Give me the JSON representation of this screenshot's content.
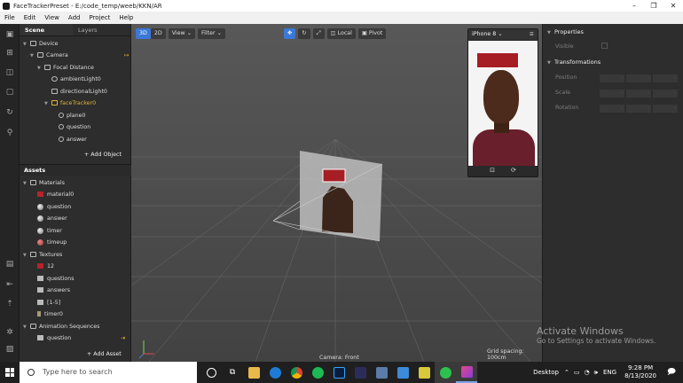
{
  "window": {
    "title": "FaceTrackerPreset - E:/code_temp/weeb/KKN/AR"
  },
  "menu": [
    "File",
    "Edit",
    "View",
    "Add",
    "Project",
    "Help"
  ],
  "scene_panel": {
    "tabs": [
      "Scene",
      "Layers"
    ],
    "tree": [
      {
        "label": "Device",
        "indent": 0
      },
      {
        "label": "Camera",
        "indent": 1
      },
      {
        "label": "Focal Distance",
        "indent": 2
      },
      {
        "label": "ambientLight0",
        "indent": 3
      },
      {
        "label": "directionalLight0",
        "indent": 3
      },
      {
        "label": "faceTracker0",
        "indent": 3
      },
      {
        "label": "plane0",
        "indent": 4
      },
      {
        "label": "question",
        "indent": 4
      },
      {
        "label": "answer",
        "indent": 4
      }
    ],
    "add_object": "+ Add Object"
  },
  "assets": {
    "header": "Assets",
    "materials_label": "Materials",
    "materials": [
      "material0",
      "question",
      "answer",
      "timer",
      "timeup"
    ],
    "textures_label": "Textures",
    "textures": [
      "12",
      "questions",
      "answers",
      "[1-5]",
      "timer0"
    ],
    "anim_label": "Animation Sequences",
    "anims": [
      "question"
    ],
    "add_asset": "+ Add Asset"
  },
  "viewport": {
    "toolbar": {
      "b3d": "3D",
      "b2d": "2D",
      "view": "View",
      "filter": "Filter",
      "local": "Local",
      "pivot": "Pivot"
    },
    "device": "iPhone 8",
    "camera_label": "Camera: Front",
    "grid_spacing": "Grid spacing: 100cm"
  },
  "properties": {
    "header": "Properties",
    "visible_label": "Visible",
    "transform_header": "Transformations",
    "position_label": "Position",
    "scale_label": "Scale",
    "rotation_label": "Rotation"
  },
  "watermark": {
    "line1": "Activate Windows",
    "line2": "Go to Settings to activate Windows."
  },
  "taskbar": {
    "search_placeholder": "Type here to search",
    "desktop": "Desktop",
    "lang": "ENG",
    "time": "9:28 PM",
    "date": "8/13/2020"
  }
}
